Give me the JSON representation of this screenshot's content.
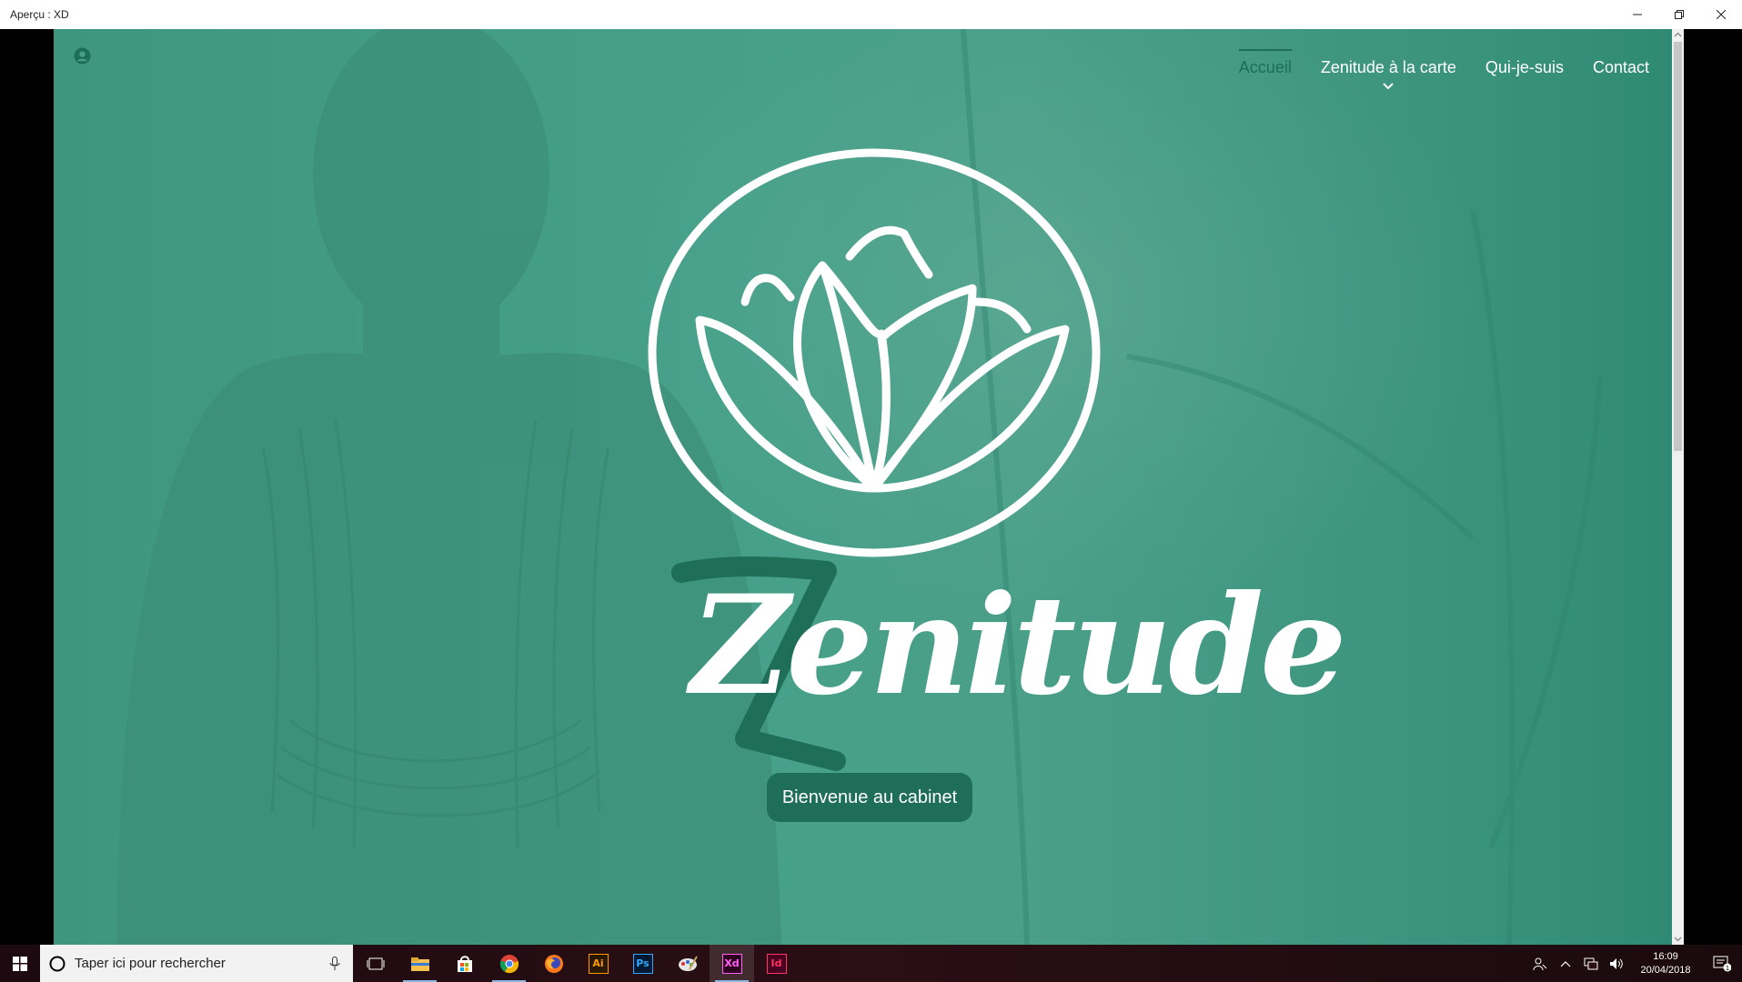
{
  "window": {
    "title": "Aperçu : XD",
    "controls": [
      "minimize-icon",
      "restore-icon",
      "close-icon"
    ]
  },
  "nav": {
    "user_icon": "user-circle-icon",
    "items": [
      {
        "label": "Accueil",
        "active": true
      },
      {
        "label": "Zenitude à la carte",
        "has_submenu": true
      },
      {
        "label": "Qui-je-suis"
      },
      {
        "label": "Contact"
      }
    ]
  },
  "hero": {
    "brand": "Zenitude",
    "logo_icon": "lotus-icon",
    "cta_label": "Bienvenue au cabinet"
  },
  "colors": {
    "overlay_teal": "#46a089",
    "accent_dark_green": "#1f6e59",
    "white": "#ffffff"
  },
  "taskbar": {
    "search_placeholder": "Taper ici pour rechercher",
    "apps": [
      {
        "name": "task-view-icon"
      },
      {
        "name": "file-explorer-icon",
        "running": true
      },
      {
        "name": "store-icon"
      },
      {
        "name": "chrome-icon",
        "running": true
      },
      {
        "name": "firefox-icon"
      },
      {
        "name": "illustrator-icon",
        "label": "Ai"
      },
      {
        "name": "photoshop-icon",
        "label": "Ps"
      },
      {
        "name": "paint-icon"
      },
      {
        "name": "xd-icon",
        "label": "Xd",
        "running": true,
        "active": true
      },
      {
        "name": "indesign-icon",
        "label": "Id"
      }
    ],
    "time": "16:09",
    "date": "20/04/2018",
    "notification_count": "1"
  }
}
